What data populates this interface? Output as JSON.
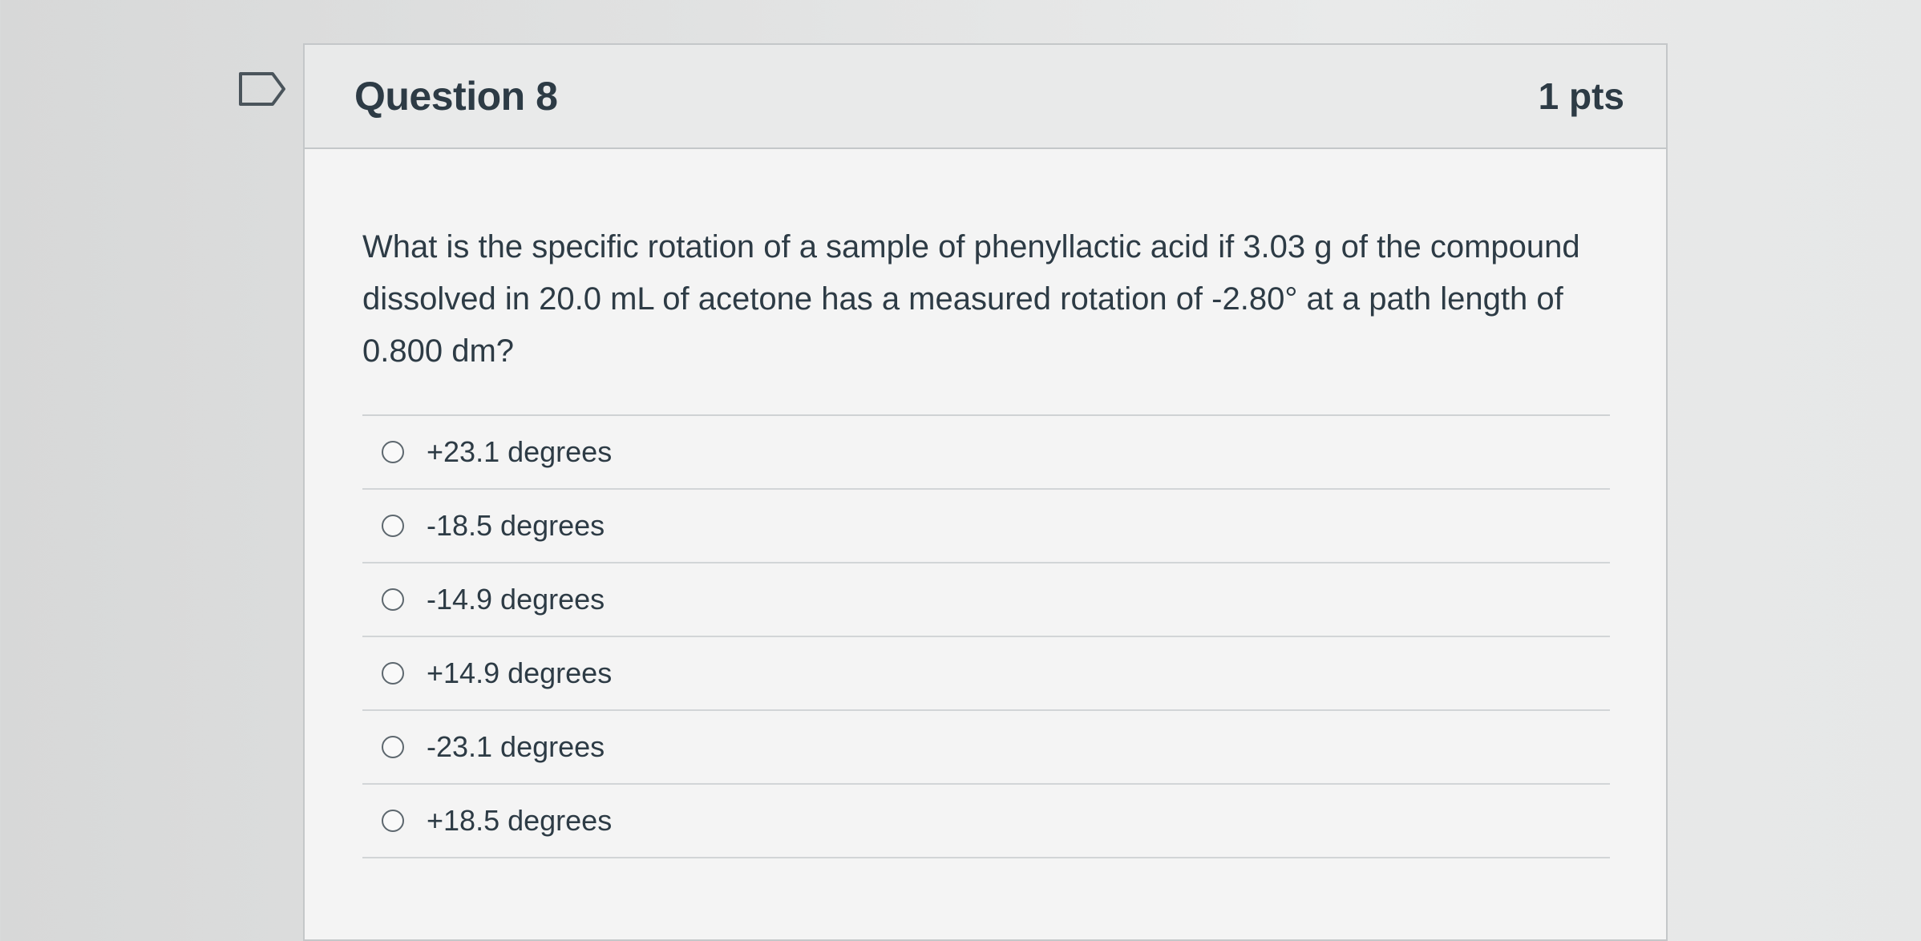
{
  "question": {
    "title": "Question 8",
    "points": "1 pts",
    "text": "What is the specific rotation of a sample of phenyllactic acid if 3.03 g of the compound dissolved in 20.0 mL of acetone has a measured rotation of -2.80° at a path length of 0.800 dm?",
    "flag_icon": "bookmark-flag-icon",
    "answers": [
      {
        "label": "+23.1 degrees",
        "selected": false
      },
      {
        "label": "-18.5 degrees",
        "selected": false
      },
      {
        "label": "-14.9 degrees",
        "selected": false
      },
      {
        "label": "+14.9 degrees",
        "selected": false
      },
      {
        "label": "-23.1 degrees",
        "selected": false
      },
      {
        "label": "+18.5 degrees",
        "selected": false
      }
    ]
  },
  "colors": {
    "text": "#2d3b45",
    "header_bg": "#e9eaea",
    "card_bg": "#f4f4f4",
    "border": "#c4c7c9"
  }
}
